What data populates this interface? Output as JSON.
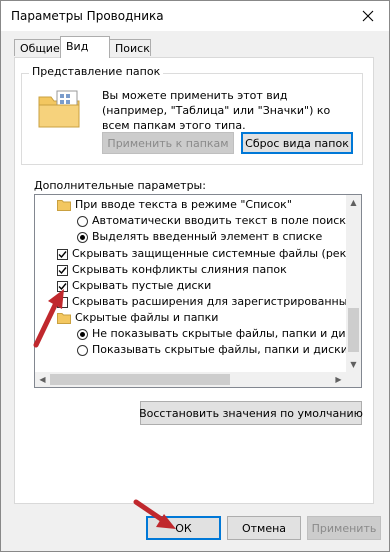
{
  "window": {
    "title": "Параметры Проводника"
  },
  "tabs": [
    {
      "label": "Общие",
      "active": false
    },
    {
      "label": "Вид",
      "active": true
    },
    {
      "label": "Поиск",
      "active": false
    }
  ],
  "folder_view": {
    "group_title": "Представление папок",
    "description": "Вы можете применить этот вид (например, \"Таблица\" или \"Значки\") ко всем папкам этого типа.",
    "apply_label": "Применить к папкам",
    "reset_label": "Сброс вида папок"
  },
  "advanced": {
    "label": "Дополнительные параметры:",
    "items": [
      {
        "type": "folder",
        "text": "При вводе текста в режиме \"Список\""
      },
      {
        "type": "radio",
        "checked": false,
        "text": "Автоматически вводить текст в поле поиска"
      },
      {
        "type": "radio",
        "checked": true,
        "text": "Выделять введенный элемент в списке"
      },
      {
        "type": "checkbox",
        "checked": true,
        "text": "Скрывать защищенные системные файлы (рекомен"
      },
      {
        "type": "checkbox",
        "checked": true,
        "text": "Скрывать конфликты слияния папок"
      },
      {
        "type": "checkbox",
        "checked": true,
        "text": "Скрывать пустые диски"
      },
      {
        "type": "checkbox",
        "checked": false,
        "text": "Скрывать расширения для зарегистрированных типо"
      },
      {
        "type": "folder",
        "text": "Скрытые файлы и папки"
      },
      {
        "type": "radio",
        "checked": true,
        "text": "Не показывать скрытые файлы, папки и диски"
      },
      {
        "type": "radio",
        "checked": false,
        "text": "Показывать скрытые файлы, папки и диски"
      }
    ]
  },
  "restore_label": "Восстановить значения по умолчанию",
  "footer": {
    "ok_label": "ОК",
    "cancel_label": "Отмена",
    "apply_label": "Применить"
  },
  "colors": {
    "accent": "#0078d7",
    "annotation_arrow": "#c0282d",
    "folder": "#f3c760"
  },
  "icons": {
    "close": "close-icon",
    "folder_view": "folder-grid-icon",
    "group_folder": "folder-icon",
    "annotation": "red-arrow-icon"
  }
}
